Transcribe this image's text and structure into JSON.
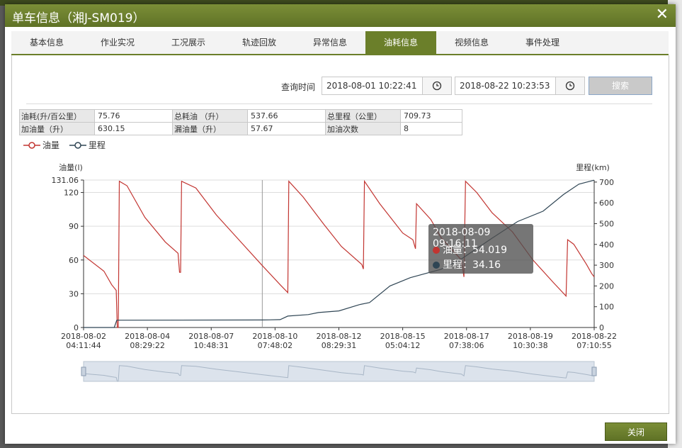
{
  "dialog": {
    "title": "单车信息（湘J-SM019）",
    "close_label": "✕"
  },
  "tabs": [
    {
      "label": "基本信息",
      "active": false
    },
    {
      "label": "作业实况",
      "active": false
    },
    {
      "label": "工况展示",
      "active": false
    },
    {
      "label": "轨迹回放",
      "active": false
    },
    {
      "label": "异常信息",
      "active": false
    },
    {
      "label": "油耗信息",
      "active": true
    },
    {
      "label": "视频信息",
      "active": false
    },
    {
      "label": "事件处理",
      "active": false
    }
  ],
  "query": {
    "label": "查询时间",
    "start": "2018-08-01 10:22:41",
    "end": "2018-08-22 10:23:53",
    "search_label": "搜索"
  },
  "stats": {
    "row1": [
      {
        "key": "油耗(升/百公里）",
        "value": "75.76"
      },
      {
        "key": "总耗油 （升）",
        "value": "537.66"
      },
      {
        "key": "总里程（公里）",
        "value": "709.73"
      }
    ],
    "row2": [
      {
        "key": "加油量（升）",
        "value": "630.15"
      },
      {
        "key": "漏油量（升）",
        "value": "57.67"
      },
      {
        "key": "加油次数",
        "value": "8"
      }
    ]
  },
  "legend": {
    "fuel": "油量",
    "mileage": "里程"
  },
  "tooltip": {
    "time": "2018-08-09 09:16:11",
    "fuel_text": "油量：54.019",
    "mileage_text": "里程：34.16"
  },
  "footer": {
    "close_label": "关闭"
  },
  "colors": {
    "accent": "#6b7f2a",
    "fuel": "#c23531",
    "mileage": "#2f4554"
  },
  "chart_data": {
    "type": "line",
    "y_left_label": "油量(l)",
    "y_right_label": "里程(km)",
    "y_left_ticks": [
      0,
      30,
      60,
      90,
      120,
      131.06
    ],
    "y_left_ticks_text": [
      "0",
      "30",
      "60",
      "90",
      "120",
      "131.06"
    ],
    "y_right_ticks": [
      0,
      100,
      200,
      300,
      400,
      500,
      600,
      700
    ],
    "y_left_range": [
      0,
      131.06
    ],
    "y_right_range": [
      0,
      709.73
    ],
    "x_ticks": [
      {
        "t": 0,
        "date": "2018-08-02",
        "time": "04:11:44"
      },
      {
        "t": 0.125,
        "date": "2018-08-04",
        "time": "08:29:22"
      },
      {
        "t": 0.25,
        "date": "2018-08-07",
        "time": "10:48:31"
      },
      {
        "t": 0.375,
        "date": "2018-08-10",
        "time": "07:48:02"
      },
      {
        "t": 0.5,
        "date": "2018-08-12",
        "time": "08:29:31"
      },
      {
        "t": 0.625,
        "date": "2018-08-15",
        "time": "05:04:12"
      },
      {
        "t": 0.75,
        "date": "2018-08-17",
        "time": "07:38:06"
      },
      {
        "t": 0.875,
        "date": "2018-08-19",
        "time": "10:30:38"
      },
      {
        "t": 1,
        "date": "2018-08-22",
        "time": "07:10:55"
      }
    ],
    "series": [
      {
        "name": "油量",
        "axis": "left",
        "points": [
          [
            0,
            64
          ],
          [
            0.04,
            50
          ],
          [
            0.055,
            38
          ],
          [
            0.064,
            33
          ],
          [
            0.066,
            0
          ],
          [
            0.068,
            0
          ],
          [
            0.07,
            130
          ],
          [
            0.085,
            126
          ],
          [
            0.12,
            98
          ],
          [
            0.16,
            76
          ],
          [
            0.185,
            66
          ],
          [
            0.188,
            49
          ],
          [
            0.19,
            49
          ],
          [
            0.192,
            130
          ],
          [
            0.22,
            124
          ],
          [
            0.26,
            100
          ],
          [
            0.3,
            80
          ],
          [
            0.35,
            55
          ],
          [
            0.385,
            38
          ],
          [
            0.4,
            31
          ],
          [
            0.402,
            130
          ],
          [
            0.43,
            116
          ],
          [
            0.47,
            92
          ],
          [
            0.505,
            72
          ],
          [
            0.545,
            56
          ],
          [
            0.548,
            52
          ],
          [
            0.55,
            130
          ],
          [
            0.58,
            110
          ],
          [
            0.625,
            84
          ],
          [
            0.645,
            78
          ],
          [
            0.65,
            70
          ],
          [
            0.652,
            110
          ],
          [
            0.68,
            96
          ],
          [
            0.7,
            80
          ],
          [
            0.74,
            60
          ],
          [
            0.745,
            45
          ],
          [
            0.748,
            130
          ],
          [
            0.77,
            120
          ],
          [
            0.8,
            102
          ],
          [
            0.84,
            85
          ],
          [
            0.88,
            60
          ],
          [
            0.92,
            40
          ],
          [
            0.945,
            28
          ],
          [
            0.948,
            78
          ],
          [
            0.96,
            74
          ],
          [
            0.985,
            56
          ],
          [
            0.995,
            48
          ],
          [
            1,
            45
          ]
        ]
      },
      {
        "name": "里程",
        "axis": "right",
        "points": [
          [
            0,
            0
          ],
          [
            0.06,
            0
          ],
          [
            0.065,
            35
          ],
          [
            0.35,
            36
          ],
          [
            0.385,
            38
          ],
          [
            0.4,
            55
          ],
          [
            0.44,
            62
          ],
          [
            0.46,
            72
          ],
          [
            0.5,
            80
          ],
          [
            0.54,
            110
          ],
          [
            0.56,
            120
          ],
          [
            0.6,
            200
          ],
          [
            0.64,
            240
          ],
          [
            0.7,
            280
          ],
          [
            0.74,
            330
          ],
          [
            0.8,
            430
          ],
          [
            0.85,
            510
          ],
          [
            0.9,
            560
          ],
          [
            0.94,
            640
          ],
          [
            0.97,
            690
          ],
          [
            1,
            709
          ]
        ]
      }
    ]
  }
}
